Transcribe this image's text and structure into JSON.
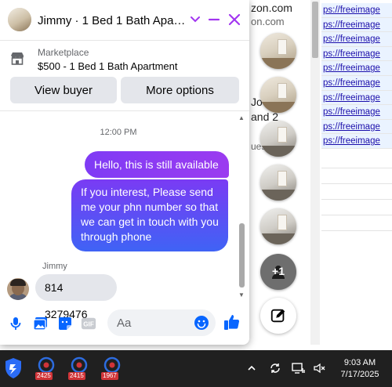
{
  "background": {
    "line1": "zon.com",
    "line2": "on.com",
    "line3": "Jo",
    "line4": "and 2",
    "line5": "ues",
    "links": [
      "ps://freeimage",
      "ps://freeimage",
      "ps://freeimage",
      "ps://freeimage",
      "ps://freeimage",
      "ps://freeimage",
      "ps://freeimage",
      "ps://freeimage",
      "ps://freeimage",
      "ps://freeimage"
    ]
  },
  "chat": {
    "title": "Jimmy · 1 Bed 1 Bath Apart…",
    "marketplace_label": "Marketplace",
    "listing": "$500 - 1 Bed 1 Bath Apartment",
    "view_buyer_label": "View buyer",
    "more_options_label": "More options",
    "timestamp": "12:00 PM",
    "messages_out": [
      "Hello, this is still available",
      "If you interest, Please send me your phn number so that we can get in touch with you through phone"
    ],
    "sender_name": "Jimmy",
    "message_in": "814 3279476",
    "composer_placeholder": "Aa",
    "accent": "#0866ff"
  },
  "chat_heads": {
    "more_count": "+1"
  },
  "taskbar": {
    "badges": [
      "2425",
      "2415",
      "1967"
    ],
    "time": "9:03 AM",
    "date": "7/17/2025"
  }
}
